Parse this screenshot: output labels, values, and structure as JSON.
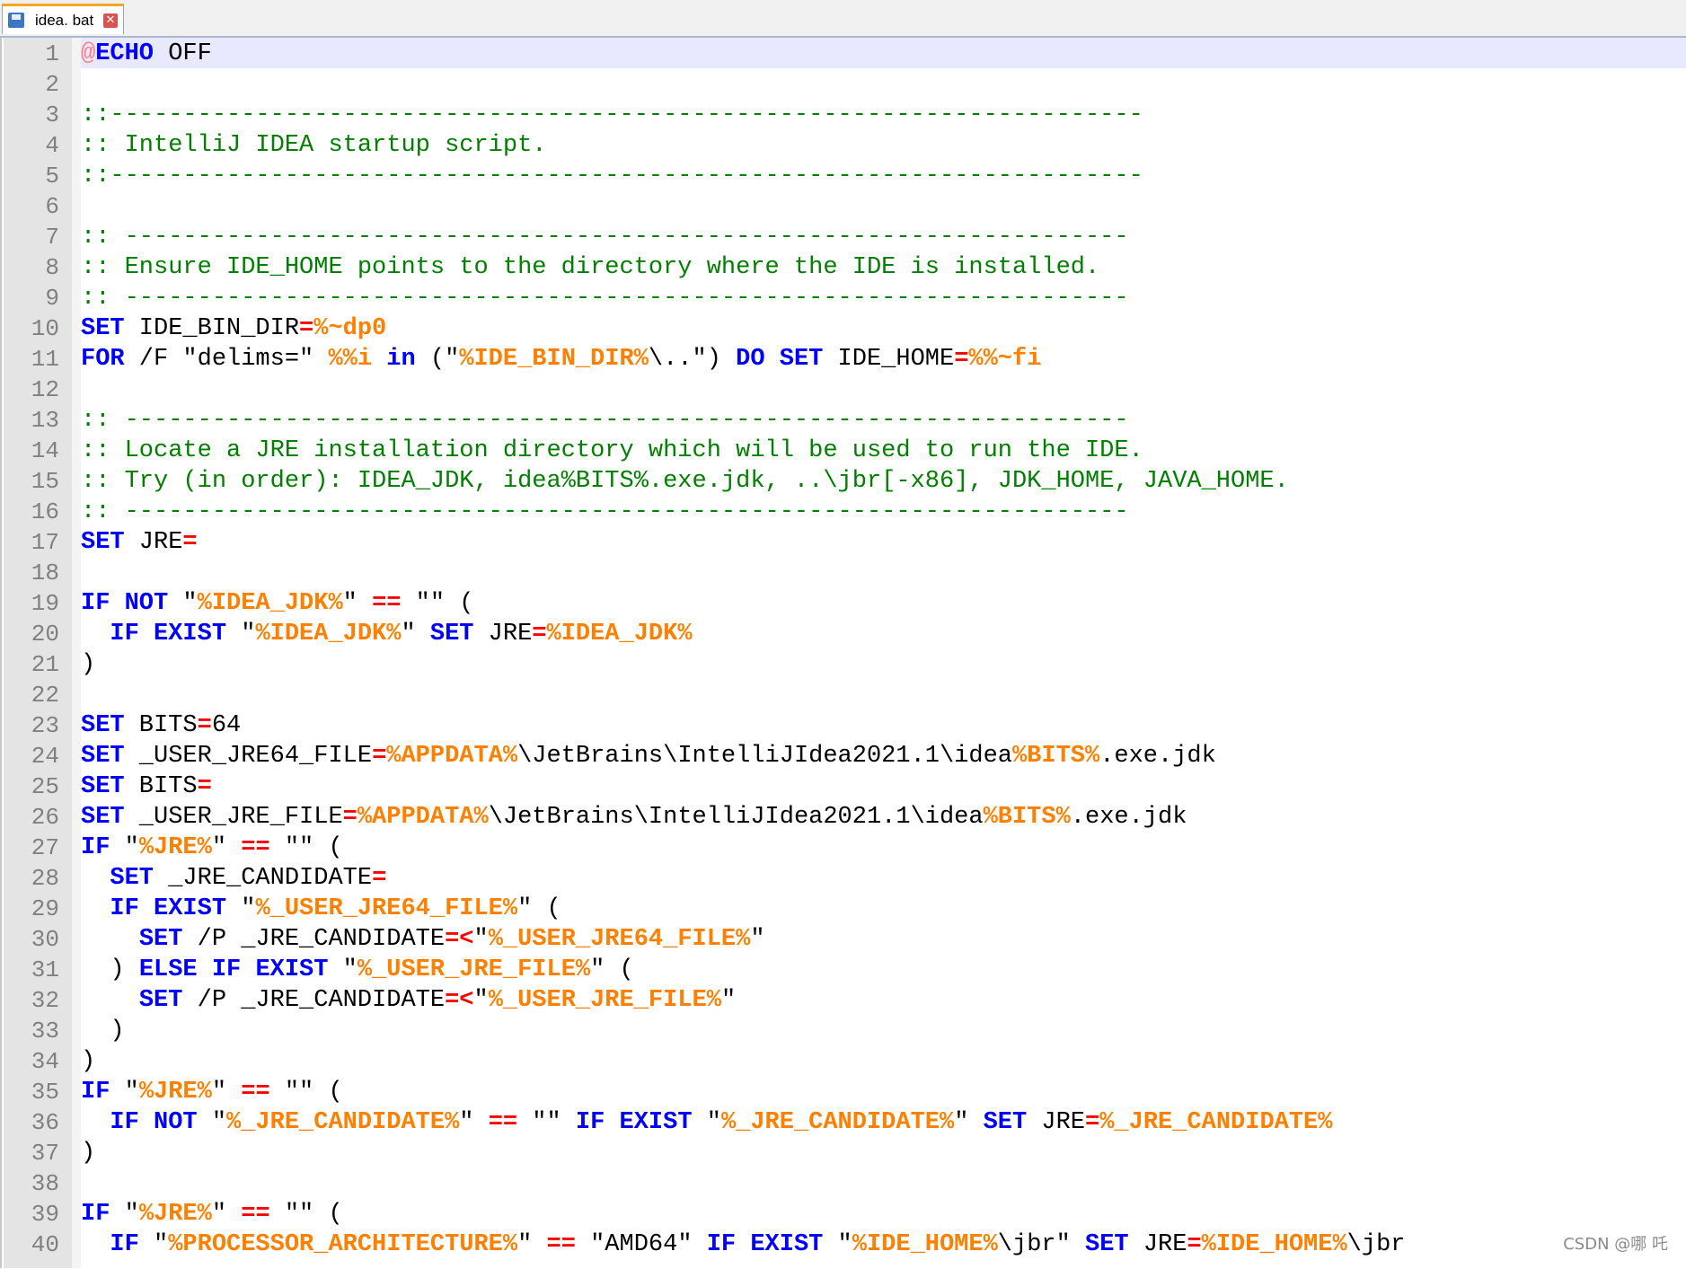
{
  "tab": {
    "label": "idea. bat",
    "close_glyph": "✕",
    "icon": "save-icon"
  },
  "watermark": "CSDN @哪 吒",
  "colors": {
    "keyword": "#0000ff",
    "variable": "#ff8000",
    "operator": "#ff0000",
    "comment": "#008000",
    "current_line": "#e8e8ff"
  },
  "lines": [
    {
      "n": "1",
      "current": true,
      "tokens": [
        [
          "at",
          "@"
        ],
        [
          "kw",
          "ECHO"
        ],
        [
          "t",
          " OFF"
        ]
      ]
    },
    {
      "n": "2",
      "tokens": []
    },
    {
      "n": "3",
      "tokens": [
        [
          "cm",
          "::-----------------------------------------------------------------------"
        ]
      ]
    },
    {
      "n": "4",
      "tokens": [
        [
          "cm",
          ":: IntelliJ IDEA startup script."
        ]
      ]
    },
    {
      "n": "5",
      "tokens": [
        [
          "cm",
          "::-----------------------------------------------------------------------"
        ]
      ]
    },
    {
      "n": "6",
      "tokens": []
    },
    {
      "n": "7",
      "tokens": [
        [
          "cm",
          ":: ---------------------------------------------------------------------"
        ]
      ]
    },
    {
      "n": "8",
      "tokens": [
        [
          "cm",
          ":: Ensure IDE_HOME points to the directory where the IDE is installed."
        ]
      ]
    },
    {
      "n": "9",
      "tokens": [
        [
          "cm",
          ":: ---------------------------------------------------------------------"
        ]
      ]
    },
    {
      "n": "10",
      "tokens": [
        [
          "kw",
          "SET"
        ],
        [
          "t",
          " IDE_BIN_DIR"
        ],
        [
          "op",
          "="
        ],
        [
          "var",
          "%~dp0"
        ]
      ]
    },
    {
      "n": "11",
      "tokens": [
        [
          "kw",
          "FOR"
        ],
        [
          "t",
          " /F \"delims=\" "
        ],
        [
          "var",
          "%%i"
        ],
        [
          "t",
          " "
        ],
        [
          "kw",
          "in"
        ],
        [
          "t",
          " (\""
        ],
        [
          "var",
          "%IDE_BIN_DIR%"
        ],
        [
          "t",
          "\\..\") "
        ],
        [
          "kw",
          "DO"
        ],
        [
          "t",
          " "
        ],
        [
          "kw",
          "SET"
        ],
        [
          "t",
          " IDE_HOME"
        ],
        [
          "op",
          "="
        ],
        [
          "var",
          "%%~fi"
        ]
      ]
    },
    {
      "n": "12",
      "tokens": []
    },
    {
      "n": "13",
      "tokens": [
        [
          "cm",
          ":: ---------------------------------------------------------------------"
        ]
      ]
    },
    {
      "n": "14",
      "tokens": [
        [
          "cm",
          ":: Locate a JRE installation directory which will be used to run the IDE."
        ]
      ]
    },
    {
      "n": "15",
      "tokens": [
        [
          "cm",
          ":: Try (in order): IDEA_JDK, idea%BITS%.exe.jdk, ..\\jbr[-x86], JDK_HOME, JAVA_HOME."
        ]
      ]
    },
    {
      "n": "16",
      "tokens": [
        [
          "cm",
          ":: ---------------------------------------------------------------------"
        ]
      ]
    },
    {
      "n": "17",
      "tokens": [
        [
          "kw",
          "SET"
        ],
        [
          "t",
          " JRE"
        ],
        [
          "op",
          "="
        ]
      ]
    },
    {
      "n": "18",
      "tokens": []
    },
    {
      "n": "19",
      "tokens": [
        [
          "kw",
          "IF"
        ],
        [
          "t",
          " "
        ],
        [
          "kw",
          "NOT"
        ],
        [
          "t",
          " \""
        ],
        [
          "var",
          "%IDEA_JDK%"
        ],
        [
          "t",
          "\" "
        ],
        [
          "op",
          "=="
        ],
        [
          "t",
          " \"\" ("
        ]
      ]
    },
    {
      "n": "20",
      "tokens": [
        [
          "t",
          "  "
        ],
        [
          "kw",
          "IF"
        ],
        [
          "t",
          " "
        ],
        [
          "kw",
          "EXIST"
        ],
        [
          "t",
          " \""
        ],
        [
          "var",
          "%IDEA_JDK%"
        ],
        [
          "t",
          "\" "
        ],
        [
          "kw",
          "SET"
        ],
        [
          "t",
          " JRE"
        ],
        [
          "op",
          "="
        ],
        [
          "var",
          "%IDEA_JDK%"
        ]
      ]
    },
    {
      "n": "21",
      "tokens": [
        [
          "t",
          ")"
        ]
      ]
    },
    {
      "n": "22",
      "tokens": []
    },
    {
      "n": "23",
      "tokens": [
        [
          "kw",
          "SET"
        ],
        [
          "t",
          " BITS"
        ],
        [
          "op",
          "="
        ],
        [
          "t",
          "64"
        ]
      ]
    },
    {
      "n": "24",
      "tokens": [
        [
          "kw",
          "SET"
        ],
        [
          "t",
          " _USER_JRE64_FILE"
        ],
        [
          "op",
          "="
        ],
        [
          "var",
          "%APPDATA%"
        ],
        [
          "t",
          "\\JetBrains\\IntelliJIdea2021.1\\idea"
        ],
        [
          "var",
          "%BITS%"
        ],
        [
          "t",
          ".exe.jdk"
        ]
      ]
    },
    {
      "n": "25",
      "tokens": [
        [
          "kw",
          "SET"
        ],
        [
          "t",
          " BITS"
        ],
        [
          "op",
          "="
        ]
      ]
    },
    {
      "n": "26",
      "tokens": [
        [
          "kw",
          "SET"
        ],
        [
          "t",
          " _USER_JRE_FILE"
        ],
        [
          "op",
          "="
        ],
        [
          "var",
          "%APPDATA%"
        ],
        [
          "t",
          "\\JetBrains\\IntelliJIdea2021.1\\idea"
        ],
        [
          "var",
          "%BITS%"
        ],
        [
          "t",
          ".exe.jdk"
        ]
      ]
    },
    {
      "n": "27",
      "tokens": [
        [
          "kw",
          "IF"
        ],
        [
          "t",
          " \""
        ],
        [
          "var",
          "%JRE%"
        ],
        [
          "t",
          "\" "
        ],
        [
          "op",
          "=="
        ],
        [
          "t",
          " \"\" ("
        ]
      ]
    },
    {
      "n": "28",
      "tokens": [
        [
          "t",
          "  "
        ],
        [
          "kw",
          "SET"
        ],
        [
          "t",
          " _JRE_CANDIDATE"
        ],
        [
          "op",
          "="
        ]
      ]
    },
    {
      "n": "29",
      "tokens": [
        [
          "t",
          "  "
        ],
        [
          "kw",
          "IF"
        ],
        [
          "t",
          " "
        ],
        [
          "kw",
          "EXIST"
        ],
        [
          "t",
          " \""
        ],
        [
          "var",
          "%_USER_JRE64_FILE%"
        ],
        [
          "t",
          "\" ("
        ]
      ]
    },
    {
      "n": "30",
      "tokens": [
        [
          "t",
          "    "
        ],
        [
          "kw",
          "SET"
        ],
        [
          "t",
          " /P _JRE_CANDIDATE"
        ],
        [
          "op",
          "=<"
        ],
        [
          "t",
          "\""
        ],
        [
          "var",
          "%_USER_JRE64_FILE%"
        ],
        [
          "t",
          "\""
        ]
      ]
    },
    {
      "n": "31",
      "tokens": [
        [
          "t",
          "  ) "
        ],
        [
          "kw",
          "ELSE"
        ],
        [
          "t",
          " "
        ],
        [
          "kw",
          "IF"
        ],
        [
          "t",
          " "
        ],
        [
          "kw",
          "EXIST"
        ],
        [
          "t",
          " \""
        ],
        [
          "var",
          "%_USER_JRE_FILE%"
        ],
        [
          "t",
          "\" ("
        ]
      ]
    },
    {
      "n": "32",
      "tokens": [
        [
          "t",
          "    "
        ],
        [
          "kw",
          "SET"
        ],
        [
          "t",
          " /P _JRE_CANDIDATE"
        ],
        [
          "op",
          "=<"
        ],
        [
          "t",
          "\""
        ],
        [
          "var",
          "%_USER_JRE_FILE%"
        ],
        [
          "t",
          "\""
        ]
      ]
    },
    {
      "n": "33",
      "tokens": [
        [
          "t",
          "  )"
        ]
      ]
    },
    {
      "n": "34",
      "tokens": [
        [
          "t",
          ")"
        ]
      ]
    },
    {
      "n": "35",
      "tokens": [
        [
          "kw",
          "IF"
        ],
        [
          "t",
          " \""
        ],
        [
          "var",
          "%JRE%"
        ],
        [
          "t",
          "\" "
        ],
        [
          "op",
          "=="
        ],
        [
          "t",
          " \"\" ("
        ]
      ]
    },
    {
      "n": "36",
      "tokens": [
        [
          "t",
          "  "
        ],
        [
          "kw",
          "IF"
        ],
        [
          "t",
          " "
        ],
        [
          "kw",
          "NOT"
        ],
        [
          "t",
          " \""
        ],
        [
          "var",
          "%_JRE_CANDIDATE%"
        ],
        [
          "t",
          "\" "
        ],
        [
          "op",
          "=="
        ],
        [
          "t",
          " \"\" "
        ],
        [
          "kw",
          "IF"
        ],
        [
          "t",
          " "
        ],
        [
          "kw",
          "EXIST"
        ],
        [
          "t",
          " \""
        ],
        [
          "var",
          "%_JRE_CANDIDATE%"
        ],
        [
          "t",
          "\" "
        ],
        [
          "kw",
          "SET"
        ],
        [
          "t",
          " JRE"
        ],
        [
          "op",
          "="
        ],
        [
          "var",
          "%_JRE_CANDIDATE%"
        ]
      ]
    },
    {
      "n": "37",
      "tokens": [
        [
          "t",
          ")"
        ]
      ]
    },
    {
      "n": "38",
      "tokens": []
    },
    {
      "n": "39",
      "tokens": [
        [
          "kw",
          "IF"
        ],
        [
          "t",
          " \""
        ],
        [
          "var",
          "%JRE%"
        ],
        [
          "t",
          "\" "
        ],
        [
          "op",
          "=="
        ],
        [
          "t",
          " \"\" ("
        ]
      ]
    },
    {
      "n": "40",
      "tokens": [
        [
          "t",
          "  "
        ],
        [
          "kw",
          "IF"
        ],
        [
          "t",
          " \""
        ],
        [
          "var",
          "%PROCESSOR_ARCHITECTURE%"
        ],
        [
          "t",
          "\" "
        ],
        [
          "op",
          "=="
        ],
        [
          "t",
          " \"AMD64\" "
        ],
        [
          "kw",
          "IF"
        ],
        [
          "t",
          " "
        ],
        [
          "kw",
          "EXIST"
        ],
        [
          "t",
          " \""
        ],
        [
          "var",
          "%IDE_HOME%"
        ],
        [
          "t",
          "\\jbr\" "
        ],
        [
          "kw",
          "SET"
        ],
        [
          "t",
          " JRE"
        ],
        [
          "op",
          "="
        ],
        [
          "var",
          "%IDE_HOME%"
        ],
        [
          "t",
          "\\jbr"
        ]
      ]
    }
  ]
}
